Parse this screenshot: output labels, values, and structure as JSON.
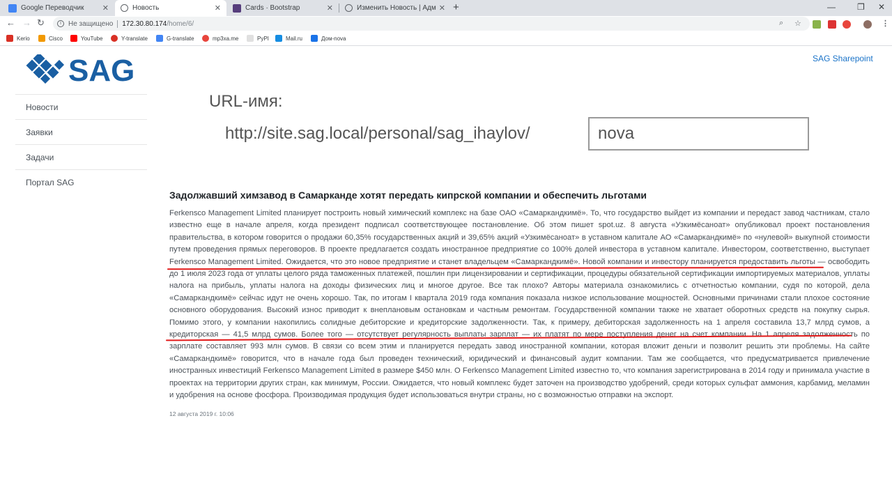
{
  "browser": {
    "tabs": [
      {
        "title": "Google Переводчик",
        "active": false,
        "favicon_color": "#4285f4"
      },
      {
        "title": "Новость",
        "active": true,
        "favicon_color": "#5f6368"
      },
      {
        "title": "Cards · Bootstrap",
        "active": false,
        "favicon_color": "#563d7c"
      },
      {
        "title": "Изменить Новость | Администр",
        "active": false,
        "favicon_color": "#5f6368"
      }
    ],
    "new_tab_symbol": "+",
    "window_controls": [
      "—",
      "❐",
      "✕"
    ],
    "nav": {
      "back": "←",
      "forward": "→",
      "reload": "↻"
    },
    "address": {
      "security_label": "Не защищено",
      "host": "172.30.80.174",
      "path": "/home/6/"
    },
    "bookmarks": [
      {
        "label": "Kerio",
        "color": "#d93025"
      },
      {
        "label": "Cisco",
        "color": "#f29900"
      },
      {
        "label": "YouTube",
        "color": "#ff0000"
      },
      {
        "label": "Y-translate",
        "color": "#d93025"
      },
      {
        "label": "G-translate",
        "color": "#4285f4"
      },
      {
        "label": "mp3xa.me",
        "color": "#e8453c"
      },
      {
        "label": "PyPI",
        "color": "#bdbdbd"
      },
      {
        "label": "Mail.ru",
        "color": "#168de2"
      },
      {
        "label": "Дом-nova",
        "color": "#1a73e8"
      }
    ]
  },
  "site": {
    "logo_text": "SAG",
    "brand_color": "#1a5fa3",
    "sharepoint_link": "SAG Sharepoint",
    "sidebar": [
      {
        "label": "Новости"
      },
      {
        "label": "Заявки"
      },
      {
        "label": "Задачи"
      },
      {
        "label": "Портал SAG"
      }
    ]
  },
  "url_panel": {
    "label": "URL-имя:",
    "prefix": "http://site.sag.local/personal/sag_ihaylov/",
    "value": "nova"
  },
  "article": {
    "title": "Задолжавший химзавод в Самарканде хотят передать кипрской компании и обеспечить льготами",
    "body": "Ferkensco Management Limited планирует построить новый химический комплекс на базе ОАО «Самаркандкимё». То, что государство выйдет из компании и передаст завод частникам, стало известно еще в начале апреля, когда президент подписал соответствующее постановление. Об этом пишет spot.uz. 8 августа «Узкимёсаноат» опубликовал проект постановления правительства, в котором говорится о продажи 60,35% государственных акций и 39,65% акций «Узкимёсаноат» в уставном капитале АО «Самаркандкимё» по «нулевой» выкупной стоимости путем проведения прямых переговоров. В проекте предлагается создать иностранное предприятие со 100% долей инвестора в уставном капитале. Инвестором, соответственно, выступает Ferkensco Management Limited. Ожидается, что это новое предприятие и станет владельцем «Самаркандкимё». Новой компании и инвестору планируется предоставить льготы — освободить до 1 июля 2023 года от уплаты целого ряда таможенных платежей, пошлин при лицензировании и сертификации, процедуры обязательной сертификации импортируемых материалов, уплаты налога на прибыль, уплаты налога на доходы физических лиц и многое другое. Все так плохо? Авторы материала ознакомились с отчетностью компании, судя по которой, дела «Самаркандкимё» сейчас идут не очень хорошо. Так, по итогам I квартала 2019 года компания показала низкое использование мощностей. Основными причинами стали плохое состояние основного оборудования. Высокий износ приводит к внеплановым остановкам и частным ремонтам. Государственной компании также не хватает оборотных средств на покупку сырья. Помимо этого, у компании накопились солидные дебиторские и кредиторские задолженности. Так, к примеру, дебиторская задолженность на 1 апреля составила 13,7 млрд сумов, а кредиторская — 41,5 млрд сумов. Более того — отсутствует регулярность выплаты зарплат — их платят по мере поступления денег на счет компании. На 1 апреля задолженность по зарплате составляет 993 млн сумов. В связи со всем этим и планируется передать завод иностранной компании, которая вложит деньги и позволит решить эти проблемы. На сайте «Самаркандкимё» говорится, что в начале года был проведен технический, юридический и финансовый аудит компании. Там же сообщается, что предусматривается привлечение иностранных инвестиций Ferkensco Management Limited в размере $450 млн. О Ferkensco Management Limited известно то, что компания зарегистрирована в 2014 году и принимала участие в проектах на территории других стран, как минимум, России. Ожидается, что новый комплекс будет заточен на производство удобрений, среди которых сульфат аммония, карбамид, меламин и удобрения на основе фосфора. Производимая продукция будет использоваться внутри страны, но с возможностью отправки на экспорт.",
    "date": "12 августа 2019 г. 10:06",
    "annotation_color": "#e21a1a"
  }
}
